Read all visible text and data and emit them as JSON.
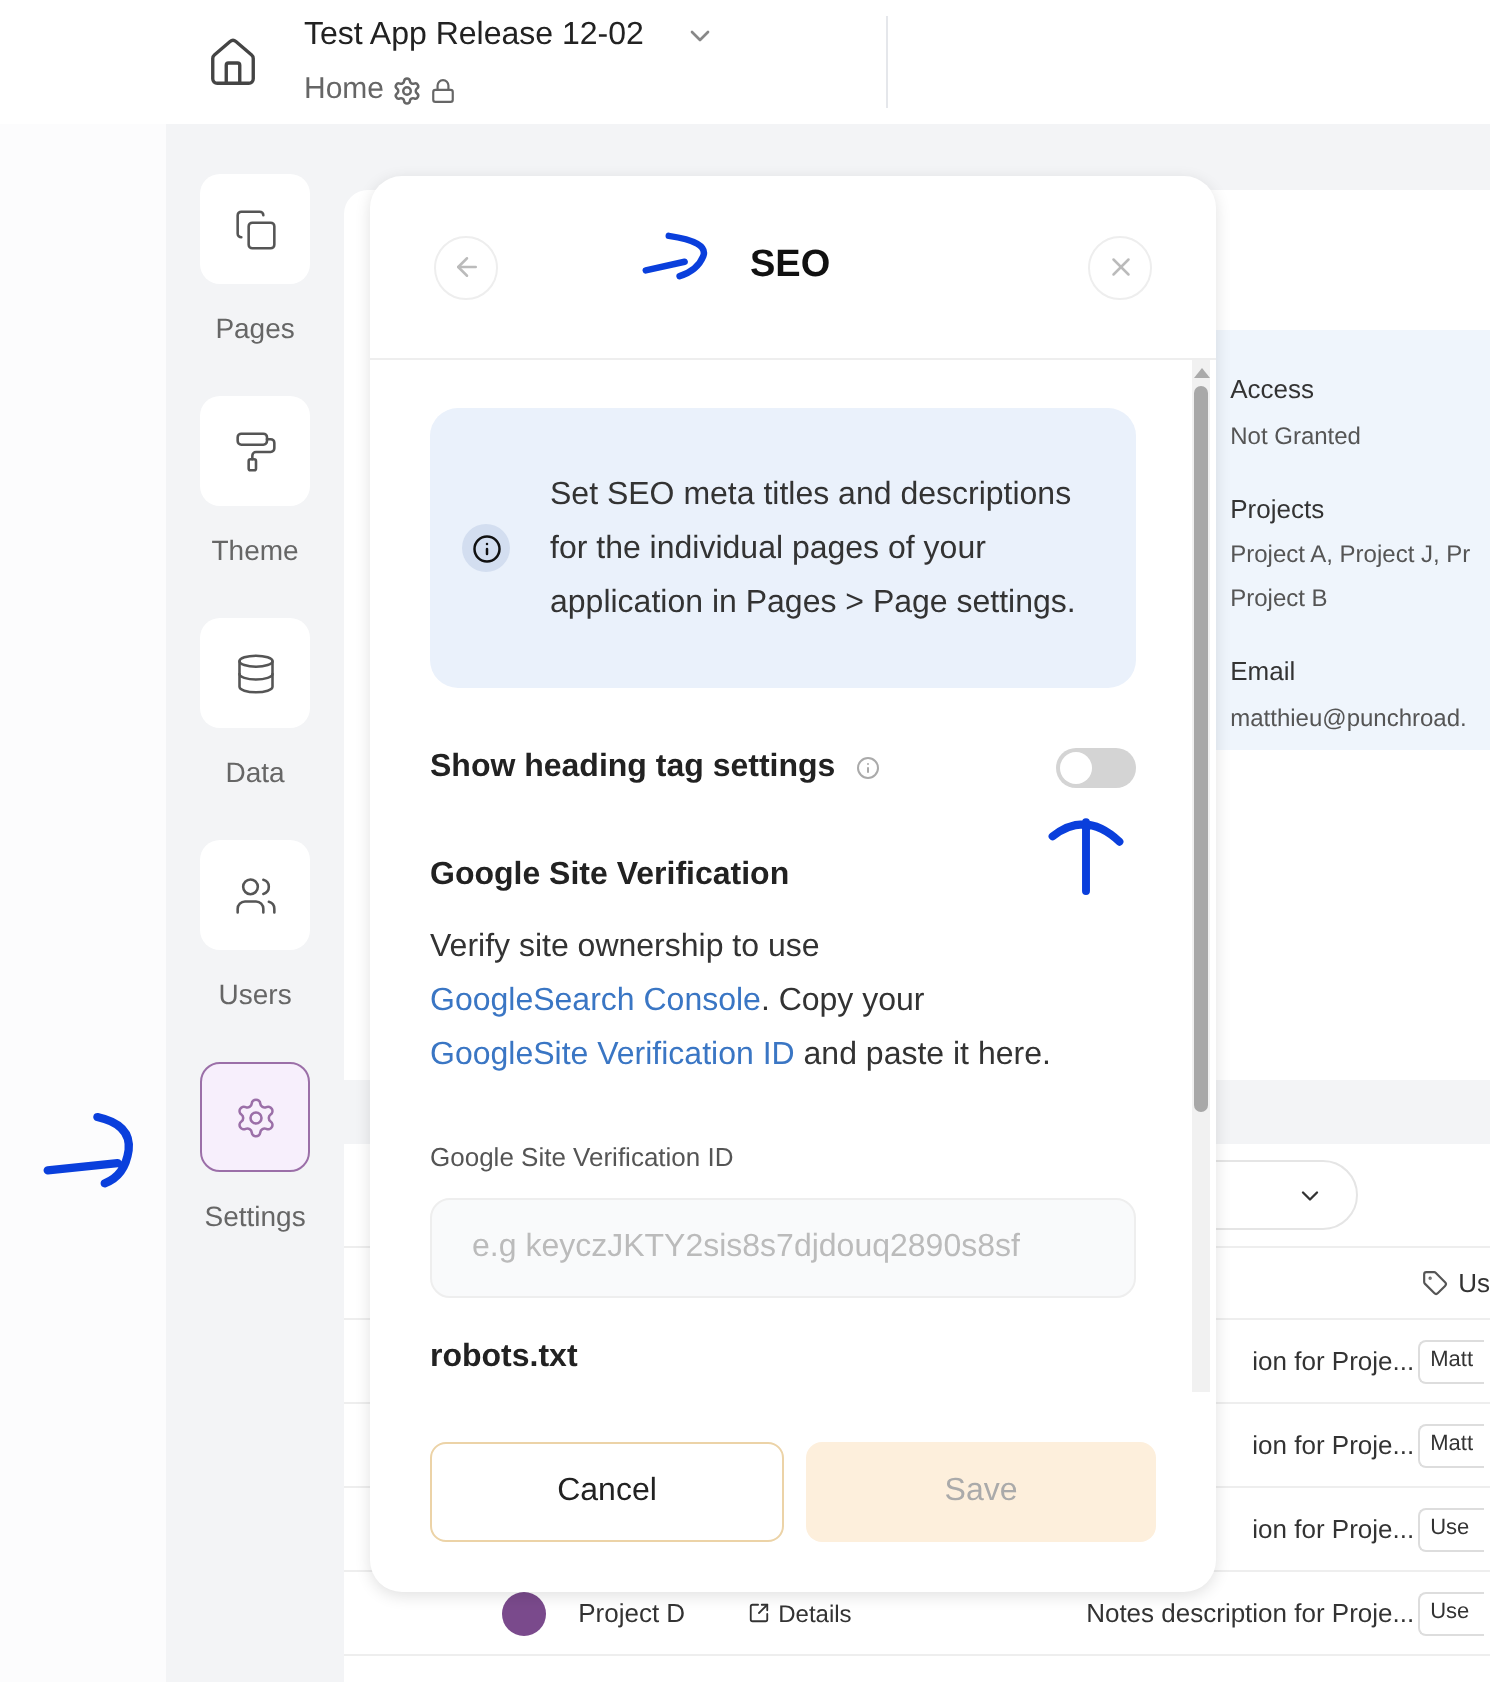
{
  "header": {
    "app_name": "Test App Release 12-02",
    "page": "Home"
  },
  "sidebar": {
    "items": [
      {
        "label": "Pages",
        "selected": false
      },
      {
        "label": "Theme",
        "selected": false
      },
      {
        "label": "Data",
        "selected": false
      },
      {
        "label": "Users",
        "selected": false
      },
      {
        "label": "Settings",
        "selected": true
      }
    ]
  },
  "user_card": {
    "fields": [
      {
        "label": "Access",
        "lines": [
          "Not Granted"
        ]
      },
      {
        "label": "Projects",
        "lines": [
          "Project A, Project J, Pr",
          "Project B"
        ]
      },
      {
        "label": "Email",
        "lines": [
          "matthieu@punchroad."
        ]
      }
    ]
  },
  "table": {
    "column_header": "Us",
    "rows": [
      {
        "description": "ion for Proje...",
        "user": "Matt"
      },
      {
        "description": "ion for Proje...",
        "user": "Matt"
      },
      {
        "description": "ion for Proje...",
        "user": "Use"
      },
      {
        "project": "Project D",
        "action": "Details",
        "description": "Notes description for Proje...",
        "user": "Use"
      }
    ]
  },
  "modal": {
    "title": "SEO",
    "info": "Set SEO meta titles and descriptions for the individual pages of your application in Pages > Page settings.",
    "toggle": {
      "label": "Show heading tag settings",
      "on": false
    },
    "section_title": "Google Site Verification",
    "description": [
      {
        "text": "Verify site ownership to use ",
        "link": false
      },
      {
        "text": "GoogleSearch Console",
        "link": true
      },
      {
        "text": ". Copy your ",
        "link": false
      },
      {
        "text": "GoogleSite Verification ID",
        "link": true
      },
      {
        "text": " and paste it here.",
        "link": false
      }
    ],
    "field": {
      "label": "Google Site Verification ID",
      "placeholder": "e.g keyczJKTY2sis8s7djdouq2890s8sf"
    },
    "robots_title": "robots.txt",
    "buttons": [
      {
        "label": "Cancel",
        "kind": "secondary",
        "disabled": false
      },
      {
        "label": "Save",
        "kind": "primary",
        "disabled": true
      }
    ]
  }
}
